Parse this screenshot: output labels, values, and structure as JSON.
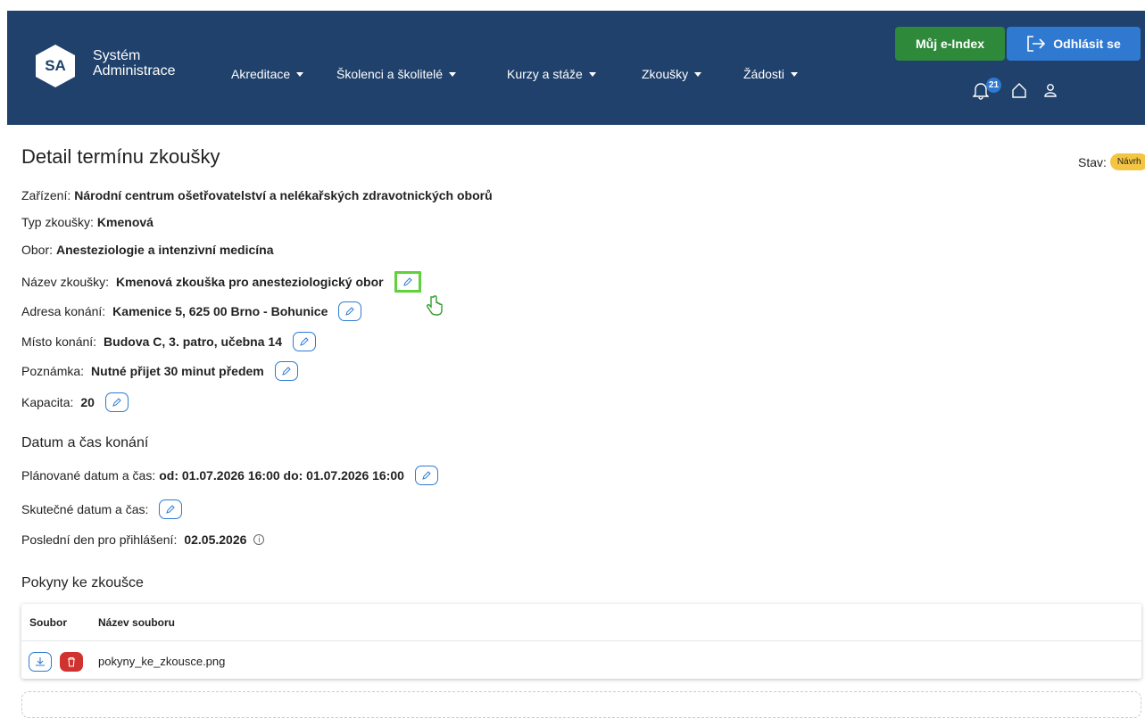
{
  "header": {
    "logo_initials": "SA",
    "logo_line1": "Systém",
    "logo_line2": "Administrace",
    "nav": [
      {
        "label": "Akreditace"
      },
      {
        "label": "Školenci a školitelé"
      },
      {
        "label": "Kurzy a stáže"
      },
      {
        "label": "Zkoušky"
      },
      {
        "label": "Žádosti"
      }
    ],
    "eindex_label": "Můj e-Index",
    "logout_label": "Odhlásit se",
    "notification_count": "21"
  },
  "page": {
    "title": "Detail termínu zkoušky",
    "status_label": "Stav:",
    "status_value": "Návrh"
  },
  "details": {
    "zarizeni_label": "Zařízení:",
    "zarizeni_value": "Národní centrum ošetřovatelství a nelékařských zdravotnických oborů",
    "typ_label": "Typ zkoušky:",
    "typ_value": "Kmenová",
    "obor_label": "Obor:",
    "obor_value": "Anesteziologie a intenzivní medicína",
    "nazev_label": "Název zkoušky:",
    "nazev_value": "Kmenová zkouška pro anesteziologický obor",
    "adresa_label": "Adresa konání:",
    "adresa_value": "Kamenice 5, 625 00 Brno - Bohunice",
    "misto_label": "Místo konání:",
    "misto_value": "Budova C, 3. patro, učebna 14",
    "poznamka_label": "Poznámka:",
    "poznamka_value": "Nutné přijet 30 minut předem",
    "kapacita_label": "Kapacita:",
    "kapacita_value": "20"
  },
  "datetime": {
    "section_title": "Datum a čas konání",
    "planned_label": "Plánované datum a čas:",
    "planned_value": "od: 01.07.2026 16:00 do: 01.07.2026 16:00",
    "actual_label": "Skutečné datum a čas:",
    "deadline_label": "Poslední den pro přihlášení:",
    "deadline_value": "02.05.2026"
  },
  "instructions": {
    "section_title": "Pokyny ke zkoušce",
    "columns": [
      "Soubor",
      "Název souboru"
    ],
    "rows": [
      {
        "filename": "pokyny_ke_zkousce.png"
      }
    ]
  },
  "colors": {
    "header_bg": "#1f416b",
    "eindex_bg": "#2e8a3a",
    "logout_bg": "#2f7ad0",
    "status_badge": "#f4c542",
    "delete_bg": "#d0322f",
    "highlight": "#5fd13a"
  }
}
